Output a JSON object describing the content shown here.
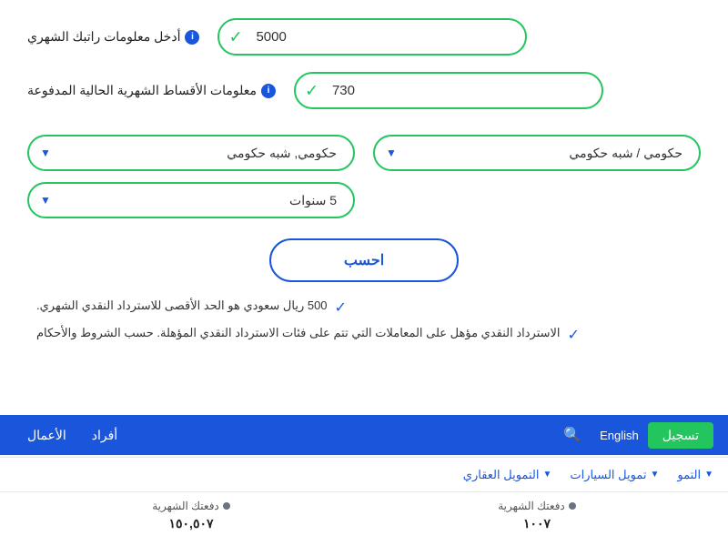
{
  "page": {
    "salary_label": "أدخل معلومات راتبك الشهري",
    "installments_label": "معلومات الأقساط الشهرية الحالية المدفوعة",
    "salary_value": "5000",
    "installment_value": "730",
    "dropdown1_label": "حكومي / شبه حكومي",
    "dropdown1_option": "حكومي / شبه حكومي",
    "dropdown2_label": "حكومي, شبه حكومي",
    "dropdown2_option": "حكومي, شبه حكومي",
    "dropdown3_label": "5 سنوات",
    "dropdown3_option": "5 سنوات",
    "calc_button": "احسب",
    "info_line1": "500 ريال سعودي هو الحد الأقصى للاسترداد النقدي الشهري.",
    "info_line2": "الاسترداد النقدي مؤهل على المعاملات التي تتم على فئات الاسترداد النقدي المؤهلة. حسب الشروط والأحكام",
    "nav_items": [
      "الأعمال",
      "أفراد"
    ],
    "nav_english": "English",
    "nav_register": "تسجيل",
    "sub_nav": [
      "التمويل العقاري",
      "تمويل السيارات",
      "التمو"
    ],
    "data_col1_label": "دفعتك الشهرية",
    "data_col1_value": "١٠٠٧",
    "data_col2_label": "دفعتك الشهرية",
    "data_col2_value": "١٥٠,٥٠٧"
  }
}
